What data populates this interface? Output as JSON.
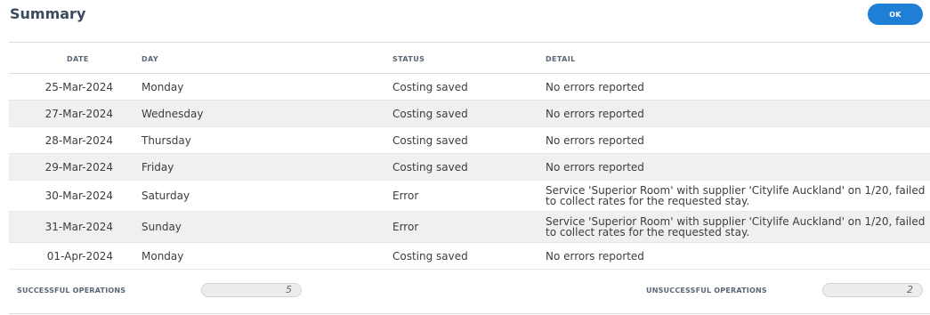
{
  "header": {
    "title": "Summary",
    "ok_label": "OK"
  },
  "columns": {
    "date": "DATE",
    "day": "DAY",
    "status": "STATUS",
    "detail": "DETAIL"
  },
  "rows": [
    {
      "date": "25-Mar-2024",
      "day": "Monday",
      "status": "Costing saved",
      "detail": "No errors reported"
    },
    {
      "date": "27-Mar-2024",
      "day": "Wednesday",
      "status": "Costing saved",
      "detail": "No errors reported"
    },
    {
      "date": "28-Mar-2024",
      "day": "Thursday",
      "status": "Costing saved",
      "detail": "No errors reported"
    },
    {
      "date": "29-Mar-2024",
      "day": "Friday",
      "status": "Costing saved",
      "detail": "No errors reported"
    },
    {
      "date": "30-Mar-2024",
      "day": "Saturday",
      "status": "Error",
      "detail": "Service 'Superior Room' with supplier 'Citylife Auckland' on 1/20, failed to collect rates for the requested stay."
    },
    {
      "date": "31-Mar-2024",
      "day": "Sunday",
      "status": "Error",
      "detail": "Service 'Superior Room' with supplier 'Citylife Auckland' on 1/20, failed to collect rates for the requested stay."
    },
    {
      "date": "01-Apr-2024",
      "day": "Monday",
      "status": "Costing saved",
      "detail": "No errors reported"
    }
  ],
  "footer": {
    "successful_label": "SUCCESSFUL OPERATIONS",
    "successful_value": "5",
    "unsuccessful_label": "UNSUCCESSFUL OPERATIONS",
    "unsuccessful_value": "2"
  },
  "colors": {
    "accent": "#1f7fd6",
    "row_alt": "#f0f0f0"
  }
}
